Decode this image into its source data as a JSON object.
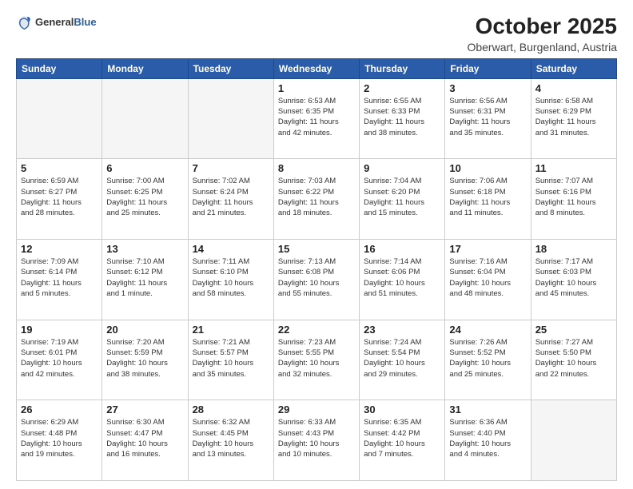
{
  "header": {
    "logo_general": "General",
    "logo_blue": "Blue",
    "title": "October 2025",
    "subtitle": "Oberwart, Burgenland, Austria"
  },
  "calendar": {
    "days_of_week": [
      "Sunday",
      "Monday",
      "Tuesday",
      "Wednesday",
      "Thursday",
      "Friday",
      "Saturday"
    ],
    "weeks": [
      [
        {
          "day": "",
          "info": ""
        },
        {
          "day": "",
          "info": ""
        },
        {
          "day": "",
          "info": ""
        },
        {
          "day": "1",
          "info": "Sunrise: 6:53 AM\nSunset: 6:35 PM\nDaylight: 11 hours\nand 42 minutes."
        },
        {
          "day": "2",
          "info": "Sunrise: 6:55 AM\nSunset: 6:33 PM\nDaylight: 11 hours\nand 38 minutes."
        },
        {
          "day": "3",
          "info": "Sunrise: 6:56 AM\nSunset: 6:31 PM\nDaylight: 11 hours\nand 35 minutes."
        },
        {
          "day": "4",
          "info": "Sunrise: 6:58 AM\nSunset: 6:29 PM\nDaylight: 11 hours\nand 31 minutes."
        }
      ],
      [
        {
          "day": "5",
          "info": "Sunrise: 6:59 AM\nSunset: 6:27 PM\nDaylight: 11 hours\nand 28 minutes."
        },
        {
          "day": "6",
          "info": "Sunrise: 7:00 AM\nSunset: 6:25 PM\nDaylight: 11 hours\nand 25 minutes."
        },
        {
          "day": "7",
          "info": "Sunrise: 7:02 AM\nSunset: 6:24 PM\nDaylight: 11 hours\nand 21 minutes."
        },
        {
          "day": "8",
          "info": "Sunrise: 7:03 AM\nSunset: 6:22 PM\nDaylight: 11 hours\nand 18 minutes."
        },
        {
          "day": "9",
          "info": "Sunrise: 7:04 AM\nSunset: 6:20 PM\nDaylight: 11 hours\nand 15 minutes."
        },
        {
          "day": "10",
          "info": "Sunrise: 7:06 AM\nSunset: 6:18 PM\nDaylight: 11 hours\nand 11 minutes."
        },
        {
          "day": "11",
          "info": "Sunrise: 7:07 AM\nSunset: 6:16 PM\nDaylight: 11 hours\nand 8 minutes."
        }
      ],
      [
        {
          "day": "12",
          "info": "Sunrise: 7:09 AM\nSunset: 6:14 PM\nDaylight: 11 hours\nand 5 minutes."
        },
        {
          "day": "13",
          "info": "Sunrise: 7:10 AM\nSunset: 6:12 PM\nDaylight: 11 hours\nand 1 minute."
        },
        {
          "day": "14",
          "info": "Sunrise: 7:11 AM\nSunset: 6:10 PM\nDaylight: 10 hours\nand 58 minutes."
        },
        {
          "day": "15",
          "info": "Sunrise: 7:13 AM\nSunset: 6:08 PM\nDaylight: 10 hours\nand 55 minutes."
        },
        {
          "day": "16",
          "info": "Sunrise: 7:14 AM\nSunset: 6:06 PM\nDaylight: 10 hours\nand 51 minutes."
        },
        {
          "day": "17",
          "info": "Sunrise: 7:16 AM\nSunset: 6:04 PM\nDaylight: 10 hours\nand 48 minutes."
        },
        {
          "day": "18",
          "info": "Sunrise: 7:17 AM\nSunset: 6:03 PM\nDaylight: 10 hours\nand 45 minutes."
        }
      ],
      [
        {
          "day": "19",
          "info": "Sunrise: 7:19 AM\nSunset: 6:01 PM\nDaylight: 10 hours\nand 42 minutes."
        },
        {
          "day": "20",
          "info": "Sunrise: 7:20 AM\nSunset: 5:59 PM\nDaylight: 10 hours\nand 38 minutes."
        },
        {
          "day": "21",
          "info": "Sunrise: 7:21 AM\nSunset: 5:57 PM\nDaylight: 10 hours\nand 35 minutes."
        },
        {
          "day": "22",
          "info": "Sunrise: 7:23 AM\nSunset: 5:55 PM\nDaylight: 10 hours\nand 32 minutes."
        },
        {
          "day": "23",
          "info": "Sunrise: 7:24 AM\nSunset: 5:54 PM\nDaylight: 10 hours\nand 29 minutes."
        },
        {
          "day": "24",
          "info": "Sunrise: 7:26 AM\nSunset: 5:52 PM\nDaylight: 10 hours\nand 25 minutes."
        },
        {
          "day": "25",
          "info": "Sunrise: 7:27 AM\nSunset: 5:50 PM\nDaylight: 10 hours\nand 22 minutes."
        }
      ],
      [
        {
          "day": "26",
          "info": "Sunrise: 6:29 AM\nSunset: 4:48 PM\nDaylight: 10 hours\nand 19 minutes."
        },
        {
          "day": "27",
          "info": "Sunrise: 6:30 AM\nSunset: 4:47 PM\nDaylight: 10 hours\nand 16 minutes."
        },
        {
          "day": "28",
          "info": "Sunrise: 6:32 AM\nSunset: 4:45 PM\nDaylight: 10 hours\nand 13 minutes."
        },
        {
          "day": "29",
          "info": "Sunrise: 6:33 AM\nSunset: 4:43 PM\nDaylight: 10 hours\nand 10 minutes."
        },
        {
          "day": "30",
          "info": "Sunrise: 6:35 AM\nSunset: 4:42 PM\nDaylight: 10 hours\nand 7 minutes."
        },
        {
          "day": "31",
          "info": "Sunrise: 6:36 AM\nSunset: 4:40 PM\nDaylight: 10 hours\nand 4 minutes."
        },
        {
          "day": "",
          "info": ""
        }
      ]
    ]
  }
}
